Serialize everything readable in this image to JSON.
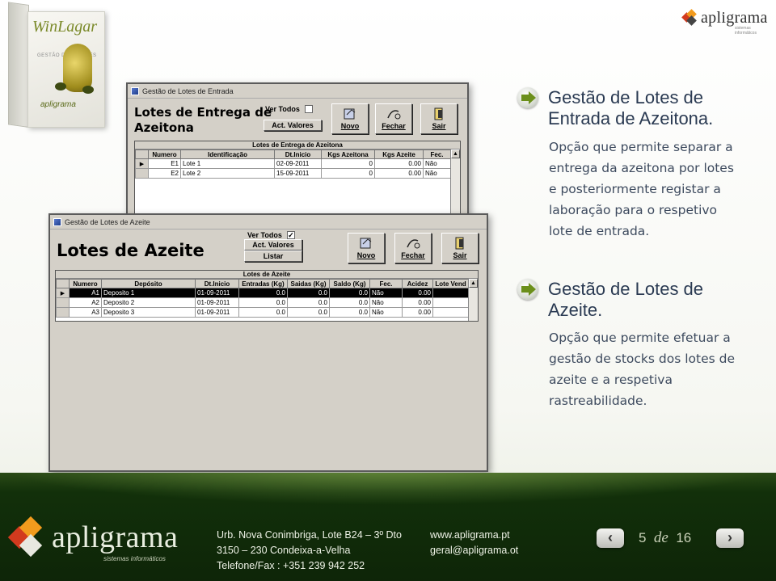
{
  "product_box": {
    "brand": "WinLagar",
    "logo": "apligrama",
    "tag": "GESTÃO DE LAGARES"
  },
  "top_logo": {
    "name": "apligrama",
    "sub": "sistemas informáticos"
  },
  "window1": {
    "title": "Gestão de Lotes de Entrada",
    "heading_line1": "Lotes de Entrega de",
    "heading_line2": "Azeitona",
    "ver_todos": "Ver Todos",
    "act_valores": "Act. Valores",
    "buttons": [
      {
        "label": "Novo",
        "icon": "new-icon"
      },
      {
        "label": "Fechar",
        "icon": "close-icon"
      },
      {
        "label": "Sair",
        "icon": "exit-icon"
      }
    ],
    "grid_caption": "Lotes de Entrega de Azeitona",
    "columns": [
      "Numero",
      "Identificação",
      "Dt.Inicio",
      "Kgs Azeitona",
      "Kgs Azeite",
      "Fec."
    ],
    "rows": [
      [
        "E1",
        "Lote 1",
        "02-09-2011",
        "0",
        "0.00",
        "Não"
      ],
      [
        "E2",
        "Lote 2",
        "15-09-2011",
        "0",
        "0.00",
        "Não"
      ]
    ]
  },
  "window2": {
    "title": "Gestão de Lotes de Azeite",
    "heading": "Lotes de Azeite",
    "ver_todos": "Ver Todos",
    "checked": "✓",
    "act_valores": "Act. Valores",
    "listar": "Listar",
    "buttons": [
      {
        "label": "Novo",
        "icon": "new-icon"
      },
      {
        "label": "Fechar",
        "icon": "close-icon"
      },
      {
        "label": "Sair",
        "icon": "exit-icon"
      }
    ],
    "grid_caption": "Lotes de Azeite",
    "columns": [
      "Numero",
      "Depósito",
      "Dt.Inicio",
      "Entradas (Kg)",
      "Saidas (Kg)",
      "Saldo (Kg)",
      "Fec.",
      "Acidez",
      "Lote Vend"
    ],
    "rows": [
      [
        "A1",
        "Deposito 1",
        "01-09-2011",
        "0.0",
        "0.0",
        "0.0",
        "Não",
        "0.00",
        ""
      ],
      [
        "A2",
        "Deposito 2",
        "01-09-2011",
        "0.0",
        "0.0",
        "0.0",
        "Não",
        "0.00",
        ""
      ],
      [
        "A3",
        "Deposito 3",
        "01-09-2011",
        "0.0",
        "0.0",
        "0.0",
        "Não",
        "0.00",
        ""
      ]
    ]
  },
  "bullets": [
    {
      "heading_l1": "Gestão de Lotes de",
      "heading_l2": "Entrada de Azeitona.",
      "lines": [
        "Opção que permite separar a",
        "entrega da azeitona por lotes",
        "e posteriormente registar a",
        "laboração para o respetivo",
        "lote de entrada."
      ]
    },
    {
      "heading_l1": "Gestão de Lotes de",
      "heading_l2": "Azeite.",
      "lines": [
        "Opção que permite efetuar a",
        "gestão de stocks dos lotes de",
        "azeite e a respetiva",
        "rastreabilidade."
      ]
    }
  ],
  "footer": {
    "logo": "apligrama",
    "logo_sub": "sistemas informáticos",
    "address": [
      "Urb. Nova Conimbriga, Lote B24 – 3º Dto",
      "3150 – 230 Condeixa-a-Velha",
      "Telefone/Fax : +351 239 942 252"
    ],
    "web": [
      "www.apligrama.pt",
      "geral@apligrama.ot"
    ],
    "page": "5",
    "de": "de",
    "total": "16"
  },
  "colors": {
    "accent": "#6b8f1b",
    "footer": "#12300a",
    "heading": "#2a3a52"
  }
}
